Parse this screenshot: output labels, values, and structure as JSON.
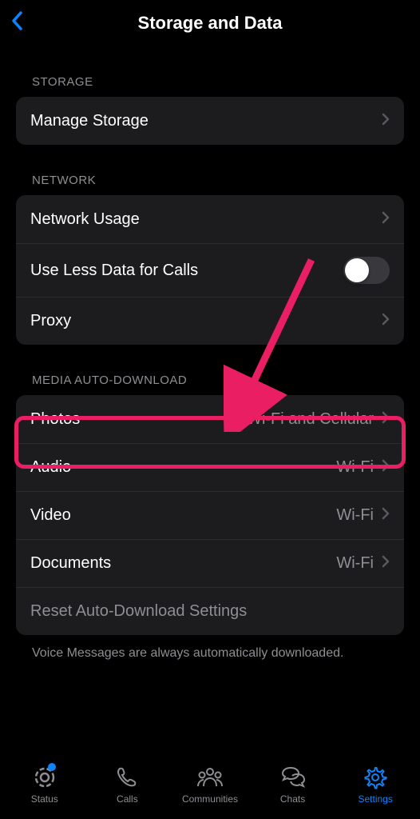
{
  "header": {
    "title": "Storage and Data"
  },
  "sections": {
    "storage": {
      "header": "STORAGE",
      "manage": "Manage Storage"
    },
    "network": {
      "header": "NETWORK",
      "usage": "Network Usage",
      "lessData": "Use Less Data for Calls",
      "proxy": "Proxy"
    },
    "media": {
      "header": "MEDIA AUTO-DOWNLOAD",
      "photos": {
        "label": "Photos",
        "value": "Wi-Fi and Cellular"
      },
      "audio": {
        "label": "Audio",
        "value": "Wi-Fi"
      },
      "video": {
        "label": "Video",
        "value": "Wi-Fi"
      },
      "documents": {
        "label": "Documents",
        "value": "Wi-Fi"
      },
      "reset": "Reset Auto-Download Settings",
      "footer": "Voice Messages are always automatically downloaded."
    }
  },
  "tabs": {
    "status": "Status",
    "calls": "Calls",
    "communities": "Communities",
    "chats": "Chats",
    "settings": "Settings"
  },
  "annotation": {
    "highlightTarget": "Photos row",
    "color": "#e91e63"
  }
}
